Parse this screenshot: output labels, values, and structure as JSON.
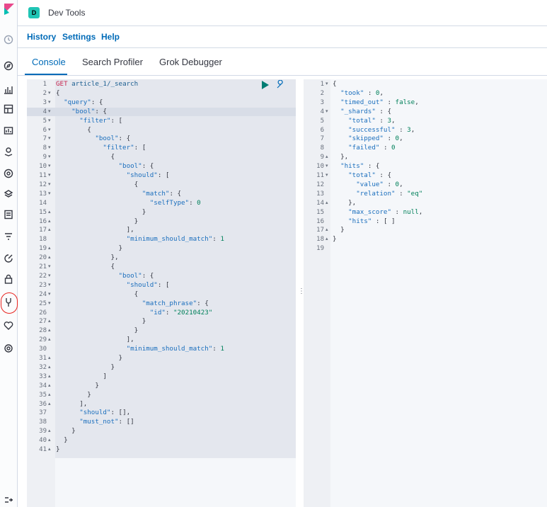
{
  "header": {
    "space_initial": "D",
    "app_title": "Dev Tools"
  },
  "submenu": {
    "items": [
      "History",
      "Settings",
      "Help"
    ]
  },
  "tabs": [
    {
      "label": "Console",
      "active": true
    },
    {
      "label": "Search Profiler",
      "active": false
    },
    {
      "label": "Grok Debugger",
      "active": false
    }
  ],
  "colors": {
    "accent": "#006bb8",
    "space_badge": "#20c5b5",
    "highlight_circle": "#e8231f"
  },
  "rail_icons": [
    "clock-icon",
    "compass-icon",
    "visualize-icon",
    "dashboard-icon",
    "canvas-icon",
    "maps-icon",
    "ml-icon",
    "stack-icon",
    "logs-icon",
    "uptime-icon",
    "apm-icon",
    "siem-icon",
    "devtools-icon",
    "monitoring-icon",
    "management-icon",
    "collapse-icon"
  ],
  "request": {
    "lines": [
      [
        [
          "tok-method",
          "GET"
        ],
        [
          "tok-plain",
          " "
        ],
        [
          "tok-url",
          "article_1/_search"
        ]
      ],
      [
        [
          "tok-plain",
          "{"
        ]
      ],
      [
        [
          "tok-plain",
          "  "
        ],
        [
          "tok-key",
          "\"query\""
        ],
        [
          "tok-plain",
          ": {"
        ]
      ],
      [
        [
          "tok-plain",
          "    "
        ],
        [
          "tok-key",
          "\"bool\""
        ],
        [
          "tok-plain",
          ": {"
        ]
      ],
      [
        [
          "tok-plain",
          "      "
        ],
        [
          "tok-key",
          "\"filter\""
        ],
        [
          "tok-plain",
          ": ["
        ]
      ],
      [
        [
          "tok-plain",
          "        {"
        ]
      ],
      [
        [
          "tok-plain",
          "          "
        ],
        [
          "tok-key",
          "\"bool\""
        ],
        [
          "tok-plain",
          ": {"
        ]
      ],
      [
        [
          "tok-plain",
          "            "
        ],
        [
          "tok-key",
          "\"filter\""
        ],
        [
          "tok-plain",
          ": ["
        ]
      ],
      [
        [
          "tok-plain",
          "              {"
        ]
      ],
      [
        [
          "tok-plain",
          "                "
        ],
        [
          "tok-key",
          "\"bool\""
        ],
        [
          "tok-plain",
          ": {"
        ]
      ],
      [
        [
          "tok-plain",
          "                  "
        ],
        [
          "tok-key",
          "\"should\""
        ],
        [
          "tok-plain",
          ": ["
        ]
      ],
      [
        [
          "tok-plain",
          "                    {"
        ]
      ],
      [
        [
          "tok-plain",
          "                      "
        ],
        [
          "tok-key",
          "\"match\""
        ],
        [
          "tok-plain",
          ": {"
        ]
      ],
      [
        [
          "tok-plain",
          "                        "
        ],
        [
          "tok-key",
          "\"selfType\""
        ],
        [
          "tok-plain",
          ": "
        ],
        [
          "tok-num",
          "0"
        ]
      ],
      [
        [
          "tok-plain",
          "                      }"
        ]
      ],
      [
        [
          "tok-plain",
          "                    }"
        ]
      ],
      [
        [
          "tok-plain",
          "                  ],"
        ]
      ],
      [
        [
          "tok-plain",
          "                  "
        ],
        [
          "tok-key",
          "\"minimum_should_match\""
        ],
        [
          "tok-plain",
          ": "
        ],
        [
          "tok-num",
          "1"
        ]
      ],
      [
        [
          "tok-plain",
          "                }"
        ]
      ],
      [
        [
          "tok-plain",
          "              },"
        ]
      ],
      [
        [
          "tok-plain",
          "              {"
        ]
      ],
      [
        [
          "tok-plain",
          "                "
        ],
        [
          "tok-key",
          "\"bool\""
        ],
        [
          "tok-plain",
          ": {"
        ]
      ],
      [
        [
          "tok-plain",
          "                  "
        ],
        [
          "tok-key",
          "\"should\""
        ],
        [
          "tok-plain",
          ": ["
        ]
      ],
      [
        [
          "tok-plain",
          "                    {"
        ]
      ],
      [
        [
          "tok-plain",
          "                      "
        ],
        [
          "tok-key",
          "\"match_phrase\""
        ],
        [
          "tok-plain",
          ": {"
        ]
      ],
      [
        [
          "tok-plain",
          "                        "
        ],
        [
          "tok-key",
          "\"id\""
        ],
        [
          "tok-plain",
          ": "
        ],
        [
          "tok-str",
          "\"20210423\""
        ]
      ],
      [
        [
          "tok-plain",
          "                      }"
        ]
      ],
      [
        [
          "tok-plain",
          "                    }"
        ]
      ],
      [
        [
          "tok-plain",
          "                  ],"
        ]
      ],
      [
        [
          "tok-plain",
          "                  "
        ],
        [
          "tok-key",
          "\"minimum_should_match\""
        ],
        [
          "tok-plain",
          ": "
        ],
        [
          "tok-num",
          "1"
        ]
      ],
      [
        [
          "tok-plain",
          "                }"
        ]
      ],
      [
        [
          "tok-plain",
          "              }"
        ]
      ],
      [
        [
          "tok-plain",
          "            ]"
        ]
      ],
      [
        [
          "tok-plain",
          "          }"
        ]
      ],
      [
        [
          "tok-plain",
          "        }"
        ]
      ],
      [
        [
          "tok-plain",
          "      ],"
        ]
      ],
      [
        [
          "tok-plain",
          "      "
        ],
        [
          "tok-key",
          "\"should\""
        ],
        [
          "tok-plain",
          ": [],"
        ]
      ],
      [
        [
          "tok-plain",
          "      "
        ],
        [
          "tok-key",
          "\"must_not\""
        ],
        [
          "tok-plain",
          ": []"
        ]
      ],
      [
        [
          "tok-plain",
          "    }"
        ]
      ],
      [
        [
          "tok-plain",
          "  }"
        ]
      ],
      [
        [
          "tok-plain",
          "}"
        ]
      ]
    ],
    "folds": {
      "2": "▾",
      "3": "▾",
      "4": "▾",
      "5": "▾",
      "6": "▾",
      "7": "▾",
      "8": "▾",
      "9": "▾",
      "10": "▾",
      "11": "▾",
      "12": "▾",
      "13": "▾",
      "15": "▴",
      "16": "▴",
      "17": "▴",
      "19": "▴",
      "20": "▴",
      "21": "▾",
      "22": "▾",
      "23": "▾",
      "24": "▾",
      "25": "▾",
      "27": "▴",
      "28": "▴",
      "29": "▴",
      "31": "▴",
      "32": "▴",
      "33": "▴",
      "34": "▴",
      "35": "▴",
      "36": "▴",
      "39": "▴",
      "40": "▴",
      "41": "▴"
    }
  },
  "response": {
    "lines": [
      [
        [
          "tok-plain",
          "{"
        ]
      ],
      [
        [
          "tok-plain",
          "  "
        ],
        [
          "tok-key",
          "\"took\""
        ],
        [
          "tok-plain",
          " : "
        ],
        [
          "tok-num",
          "0"
        ],
        [
          "tok-plain",
          ","
        ]
      ],
      [
        [
          "tok-plain",
          "  "
        ],
        [
          "tok-key",
          "\"timed_out\""
        ],
        [
          "tok-plain",
          " : "
        ],
        [
          "tok-num",
          "false"
        ],
        [
          "tok-plain",
          ","
        ]
      ],
      [
        [
          "tok-plain",
          "  "
        ],
        [
          "tok-key",
          "\"_shards\""
        ],
        [
          "tok-plain",
          " : {"
        ]
      ],
      [
        [
          "tok-plain",
          "    "
        ],
        [
          "tok-key",
          "\"total\""
        ],
        [
          "tok-plain",
          " : "
        ],
        [
          "tok-num",
          "3"
        ],
        [
          "tok-plain",
          ","
        ]
      ],
      [
        [
          "tok-plain",
          "    "
        ],
        [
          "tok-key",
          "\"successful\""
        ],
        [
          "tok-plain",
          " : "
        ],
        [
          "tok-num",
          "3"
        ],
        [
          "tok-plain",
          ","
        ]
      ],
      [
        [
          "tok-plain",
          "    "
        ],
        [
          "tok-key",
          "\"skipped\""
        ],
        [
          "tok-plain",
          " : "
        ],
        [
          "tok-num",
          "0"
        ],
        [
          "tok-plain",
          ","
        ]
      ],
      [
        [
          "tok-plain",
          "    "
        ],
        [
          "tok-key",
          "\"failed\""
        ],
        [
          "tok-plain",
          " : "
        ],
        [
          "tok-num",
          "0"
        ]
      ],
      [
        [
          "tok-plain",
          "  },"
        ]
      ],
      [
        [
          "tok-plain",
          "  "
        ],
        [
          "tok-key",
          "\"hits\""
        ],
        [
          "tok-plain",
          " : {"
        ]
      ],
      [
        [
          "tok-plain",
          "    "
        ],
        [
          "tok-key",
          "\"total\""
        ],
        [
          "tok-plain",
          " : {"
        ]
      ],
      [
        [
          "tok-plain",
          "      "
        ],
        [
          "tok-key",
          "\"value\""
        ],
        [
          "tok-plain",
          " : "
        ],
        [
          "tok-num",
          "0"
        ],
        [
          "tok-plain",
          ","
        ]
      ],
      [
        [
          "tok-plain",
          "      "
        ],
        [
          "tok-key",
          "\"relation\""
        ],
        [
          "tok-plain",
          " : "
        ],
        [
          "tok-str",
          "\"eq\""
        ]
      ],
      [
        [
          "tok-plain",
          "    },"
        ]
      ],
      [
        [
          "tok-plain",
          "    "
        ],
        [
          "tok-key",
          "\"max_score\""
        ],
        [
          "tok-plain",
          " : "
        ],
        [
          "tok-num",
          "null"
        ],
        [
          "tok-plain",
          ","
        ]
      ],
      [
        [
          "tok-plain",
          "    "
        ],
        [
          "tok-key",
          "\"hits\""
        ],
        [
          "tok-plain",
          " : [ ]"
        ]
      ],
      [
        [
          "tok-plain",
          "  }"
        ]
      ],
      [
        [
          "tok-plain",
          "}"
        ]
      ],
      [
        [
          "tok-plain",
          ""
        ]
      ]
    ],
    "folds": {
      "1": "▾",
      "4": "▾",
      "9": "▴",
      "10": "▾",
      "11": "▾",
      "14": "▴",
      "17": "▴",
      "18": "▴"
    }
  }
}
